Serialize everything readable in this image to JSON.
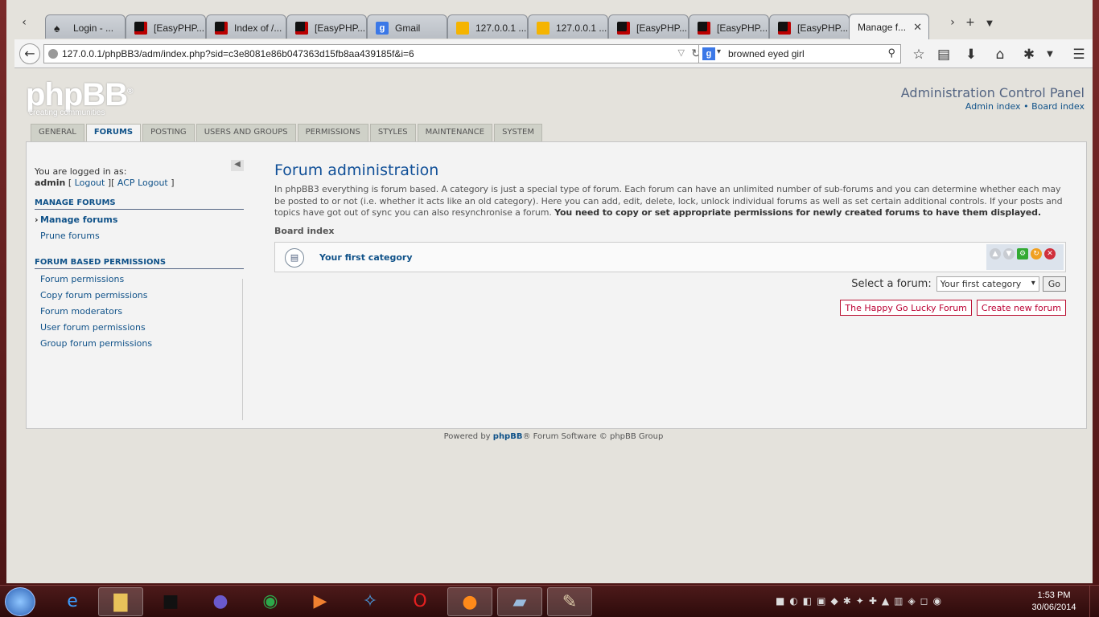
{
  "browser": {
    "tabs": [
      {
        "label": "Login - ...",
        "icon": "spade-icon"
      },
      {
        "label": "[EasyPHP...",
        "icon": "easyphp-icon"
      },
      {
        "label": "Index of /...",
        "icon": "easyphp-icon"
      },
      {
        "label": "[EasyPHP...",
        "icon": "easyphp-icon"
      },
      {
        "label": "Gmail",
        "icon": "google-icon"
      },
      {
        "label": "127.0.0.1 ...",
        "icon": "pma-icon"
      },
      {
        "label": "127.0.0.1 ...",
        "icon": "pma-icon"
      },
      {
        "label": "[EasyPHP...",
        "icon": "easyphp-icon"
      },
      {
        "label": "[EasyPHP...",
        "icon": "easyphp-icon"
      },
      {
        "label": "[EasyPHP...",
        "icon": "easyphp-icon"
      },
      {
        "label": "Manage f...",
        "icon": "none",
        "active": true
      }
    ],
    "url": "127.0.0.1/phpBB3/adm/index.php?sid=c3e8081e86b047363d15fb8aa439185f&i=6",
    "search_value": "browned eyed girl",
    "search_engine_letter": "g"
  },
  "header": {
    "logo_text": "phpBB",
    "logo_reg": "®",
    "logo_tagline": "creating communities",
    "title": "Administration Control Panel",
    "admin_index": "Admin index",
    "bullet": "•",
    "board_index": "Board index"
  },
  "menu_tabs": [
    "General",
    "Forums",
    "Posting",
    "Users and groups",
    "Permissions",
    "Styles",
    "Maintenance",
    "System"
  ],
  "sidebar": {
    "logged_in_as": "You are logged in as:",
    "username": "admin",
    "logout": "Logout",
    "acp_logout": "ACP Logout",
    "sections": [
      {
        "title": "Manage forums",
        "items": [
          "Manage forums",
          "Prune forums"
        ]
      },
      {
        "title": "Forum based permissions",
        "items": [
          "Forum permissions",
          "Copy forum permissions",
          "Forum moderators",
          "User forum permissions",
          "Group forum permissions"
        ]
      }
    ]
  },
  "main": {
    "title": "Forum administration",
    "desc": "In phpBB3 everything is forum based. A category is just a special type of forum. Each forum can have an unlimited number of sub-forums and you can determine whether each may be posted to or not (i.e. whether it acts like an old category). Here you can add, edit, delete, lock, unlock individual forums as well as set certain additional controls. If your posts and topics have got out of sync you can also resynchronise a forum.",
    "desc_bold": "You need to copy or set appropriate permissions for newly created forums to have them displayed.",
    "breadcrumb": "Board index",
    "category": "Your first category",
    "select_label": "Select a forum:",
    "select_value": "Your first category",
    "go": "Go",
    "new_forum_value": "The Happy Go Lucky Forum",
    "create_button": "Create new forum"
  },
  "footer": {
    "pre": "Powered by",
    "link": "phpBB",
    "post": "® Forum Software © phpBB Group"
  },
  "taskbar": {
    "time": "1:53 PM",
    "date": "30/06/2014"
  }
}
